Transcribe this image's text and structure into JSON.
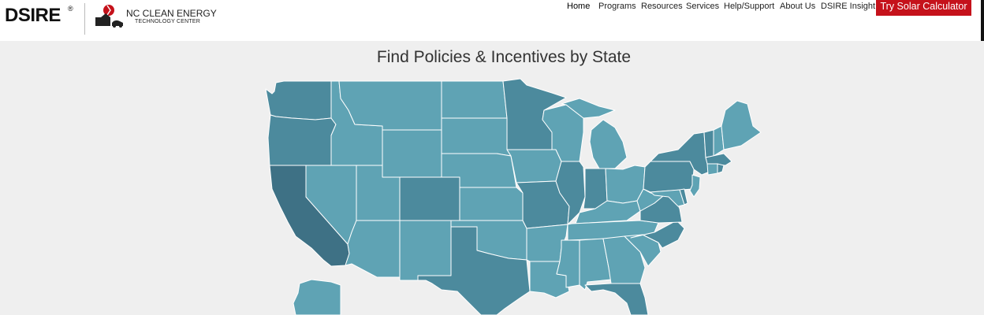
{
  "header": {
    "brand": "DSIRE",
    "brand_mark": "®",
    "partner_line1": "NC CLEAN ENERGY",
    "partner_line2": "TECHNOLOGY CENTER",
    "partner_logo_icon": "nc-state-building-icon",
    "nav": [
      "Home",
      "Programs",
      "Resources",
      "Services",
      "Help/Support",
      "About Us",
      "DSIRE Insight"
    ],
    "active_nav": "Home",
    "cta_label": "Try Solar Calculator"
  },
  "colors": {
    "cta_bg": "#c5121b",
    "fill_light": "#5fa3b4",
    "fill_mid": "#4c8a9d",
    "fill_dark": "#3e7185",
    "background": "#efefef"
  },
  "main": {
    "title": "Find Policies & Incentives by State"
  }
}
